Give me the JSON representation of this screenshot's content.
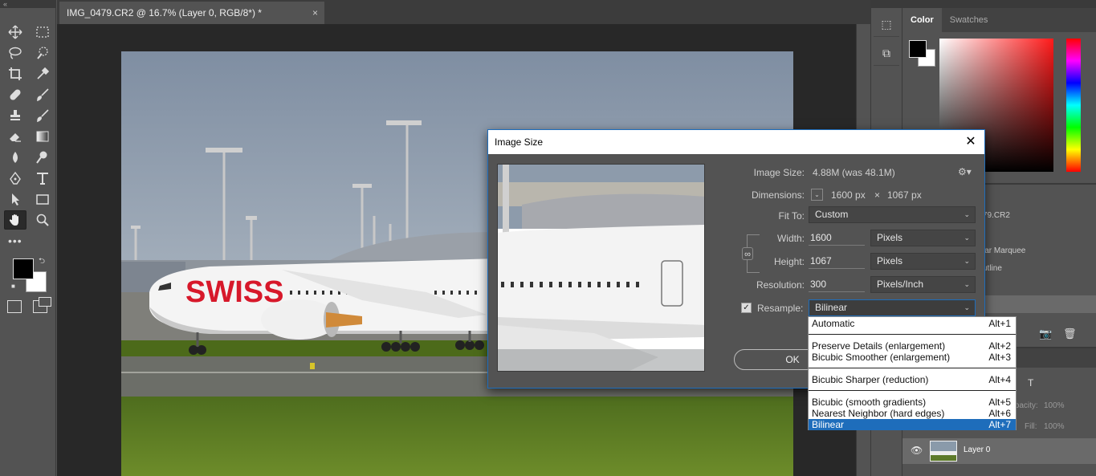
{
  "document": {
    "tab_title": "IMG_0479.CR2 @ 16.7% (Layer 0, RGB/8*) *",
    "close_glyph": "×"
  },
  "photo": {
    "logo_text": "SWISS"
  },
  "panels": {
    "color_tab": "Color",
    "swatches_tab": "Swatches",
    "history_items": [
      "79.CR2",
      "",
      "lar Marquee",
      "utline",
      ""
    ],
    "opacity_label": "Opacity:",
    "opacity_value": "100%",
    "fill_label": "Fill:",
    "fill_value": "100%",
    "layer_name": "Layer 0"
  },
  "dialog": {
    "title": "Image Size",
    "close_glyph": "✕",
    "image_size_label": "Image Size:",
    "image_size_value": "4.88M (was 48.1M)",
    "dimensions_label": "Dimensions:",
    "dimensions_width": "1600 px",
    "dimensions_times": "×",
    "dimensions_height": "1067 px",
    "fit_to_label": "Fit To:",
    "fit_to_value": "Custom",
    "width_label": "Width:",
    "width_value": "1600",
    "width_unit": "Pixels",
    "height_label": "Height:",
    "height_value": "1067",
    "height_unit": "Pixels",
    "resolution_label": "Resolution:",
    "resolution_value": "300",
    "resolution_unit": "Pixels/Inch",
    "resample_label": "Resample:",
    "resample_checked": true,
    "resample_value": "Bilinear",
    "ok_label": "OK"
  },
  "resample_menu": {
    "items": [
      {
        "label": "Automatic",
        "shortcut": "Alt+1"
      },
      {
        "label": "Preserve Details (enlargement)",
        "shortcut": "Alt+2"
      },
      {
        "label": "Bicubic Smoother (enlargement)",
        "shortcut": "Alt+3"
      },
      {
        "label": "Bicubic Sharper (reduction)",
        "shortcut": "Alt+4"
      },
      {
        "label": "Bicubic (smooth gradients)",
        "shortcut": "Alt+5"
      },
      {
        "label": "Nearest Neighbor (hard edges)",
        "shortcut": "Alt+6"
      },
      {
        "label": "Bilinear",
        "shortcut": "Alt+7"
      }
    ],
    "selected": "Bilinear"
  },
  "icons": {
    "tools": [
      "move-icon",
      "marquee-icon",
      "lasso-icon",
      "quick-select-icon",
      "crop-icon",
      "eyedropper-icon",
      "healing-icon",
      "brush-icon",
      "stamp-icon",
      "history-brush-icon",
      "eraser-icon",
      "gradient-icon",
      "blur-icon",
      "dodge-icon",
      "pen-icon",
      "type-icon",
      "path-select-icon",
      "rectangle-icon",
      "hand-icon",
      "zoom-icon"
    ]
  },
  "colors": {
    "accent": "#1e6dbb",
    "swiss_red": "#d7182a"
  }
}
